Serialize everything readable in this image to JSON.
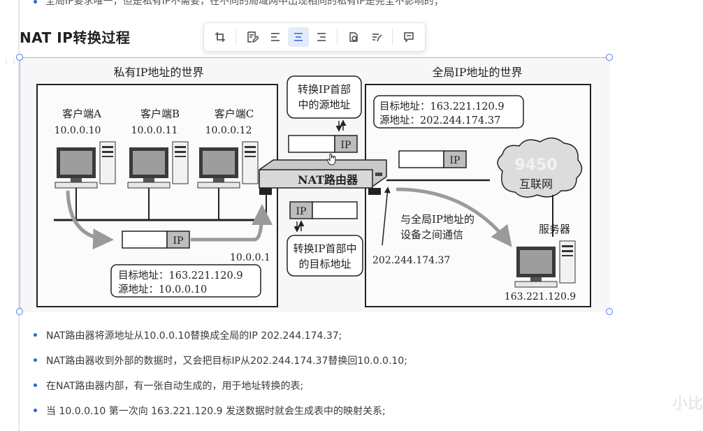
{
  "top_partial_text": "全局IP要求唯一，但是私有IP不需要，在不同的局域网中出现相同的私有IP是完全不影响的；",
  "heading": "NAT IP转换过程",
  "toolbar": {
    "buttons": [
      "crop-icon",
      "edit-icon",
      "align-left-icon",
      "align-center-icon",
      "align-right-icon",
      "link-icon",
      "transform-icon",
      "comment-icon"
    ]
  },
  "diagram": {
    "private_world_label": "私有IP地址的世界",
    "global_world_label": "全局IP地址的世界",
    "clients": [
      {
        "name": "客户端A",
        "ip": "10.0.0.10"
      },
      {
        "name": "客户端B",
        "ip": "10.0.0.11"
      },
      {
        "name": "客户端C",
        "ip": "10.0.0.12"
      }
    ],
    "convert_src_box": [
      "转换IP首部",
      "中的源地址"
    ],
    "convert_dst_box": [
      "转换IP首部中",
      "的目标地址"
    ],
    "packet_label": "IP",
    "router_label": "NAT路由器",
    "router_inner_ip": "10.0.0.1",
    "router_outer_ip": "202.244.174.37",
    "left_addr_box": {
      "dst": "目标地址：163.221.120.9",
      "src": "源地址：10.0.0.10"
    },
    "right_addr_box": {
      "dst": "目标地址：163.221.120.9",
      "src": "源地址：202.244.174.37"
    },
    "internet_label": "互联网",
    "comm_note": [
      "与全局IP地址的",
      "设备之间通信"
    ],
    "server_label": "服务器",
    "server_ip": "163.221.120.9",
    "cloud_watermark": "9450"
  },
  "bullets": [
    "NAT路由器将源地址从10.0.0.10替换成全局的IP 202.244.174.37;",
    "NAT路由器收到外部的数据时，又会把目标IP从202.244.174.37替换回10.0.0.10;",
    "在NAT路由器内部，有一张自动生成的，用于地址转换的表;",
    "当 10.0.0.10 第一次向 163.221.120.9 发送数据时就会生成表中的映射关系;"
  ],
  "watermark": "小比"
}
